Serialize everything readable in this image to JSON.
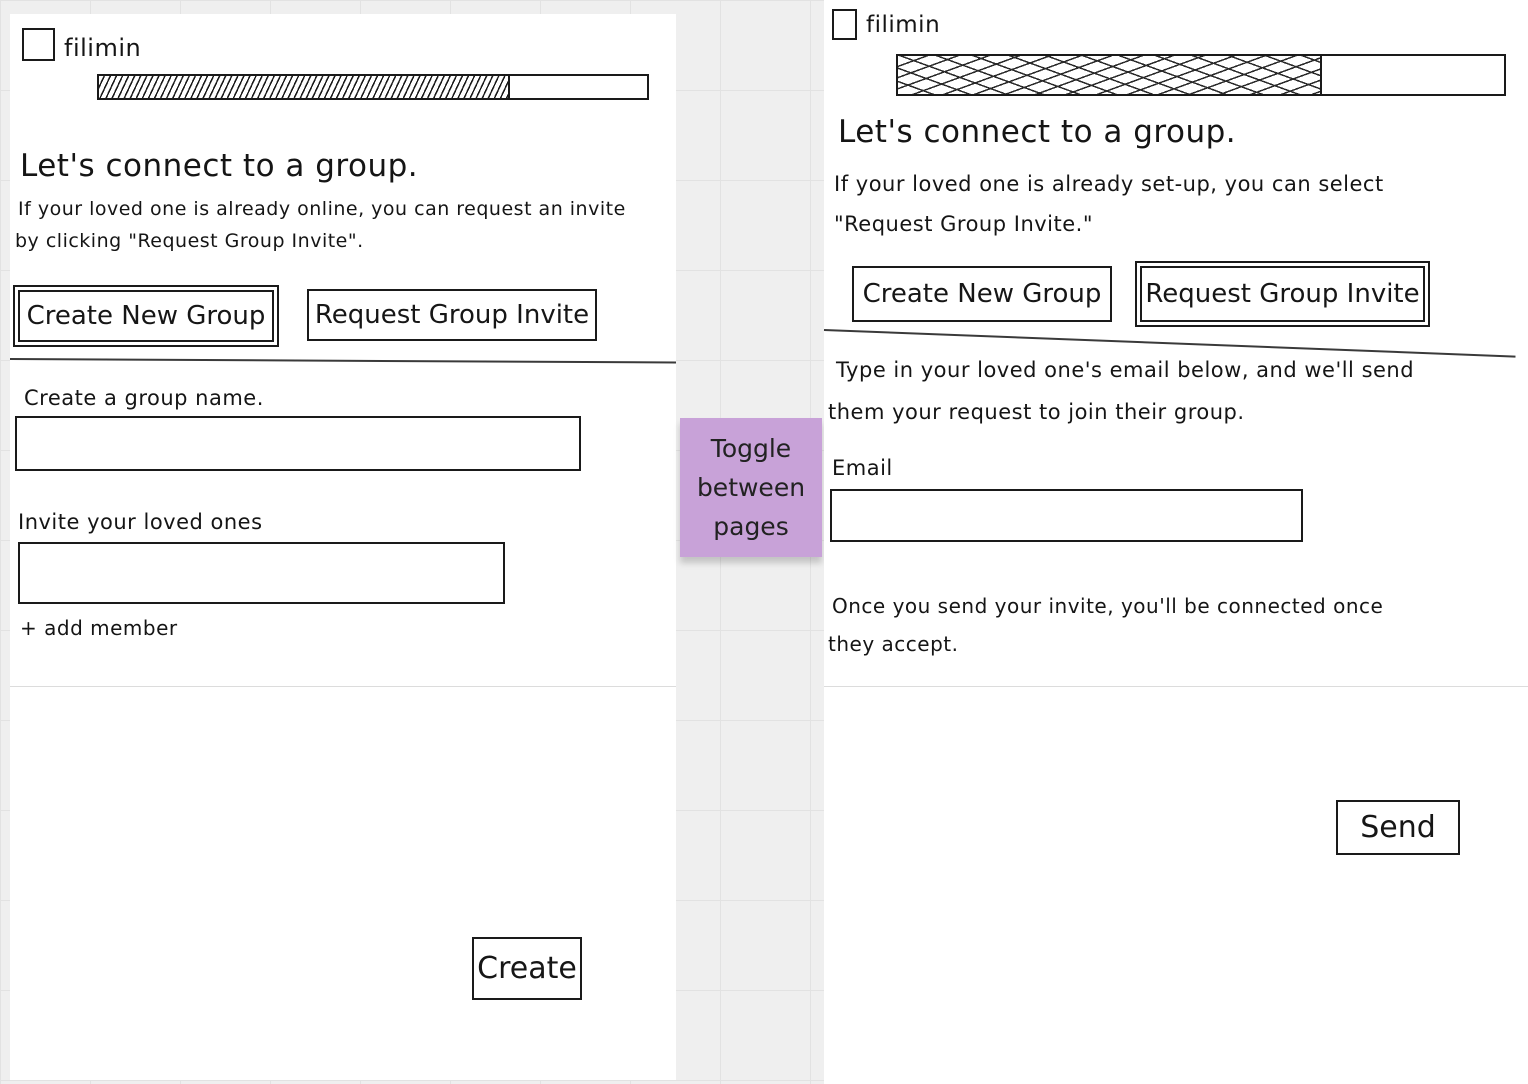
{
  "left_page": {
    "app_name": "filimin",
    "progress": 0.75,
    "heading": "Let's connect to a group.",
    "intro_line1": "If your loved one is already online, you can request an invite",
    "intro_line2": "by clicking \"Request Group Invite\".",
    "tabs": [
      {
        "label": "Create New Group",
        "selected": true
      },
      {
        "label": "Request Group Invite",
        "selected": false
      }
    ],
    "group_name_label": "Create a group name.",
    "invite_label": "Invite your loved ones",
    "add_member": "+ add member",
    "create_button": "Create"
  },
  "sticky_note": {
    "text": "Toggle\nbetween\npages",
    "color": "#c8a2d8"
  },
  "right_page": {
    "app_name": "filimin",
    "progress": 0.7,
    "heading": "Let's connect to a group.",
    "intro_line1": "If your loved one is already set-up, you can select",
    "intro_line2": "\"Request Group Invite.\"",
    "tabs": [
      {
        "label": "Create New Group",
        "selected": false
      },
      {
        "label": "Request Group Invite",
        "selected": true
      }
    ],
    "instructions_line1": "Type in your loved one's email below, and we'll send",
    "instructions_line2": "them your request to join their group.",
    "email_label": "Email",
    "note_line1": "Once you send your invite, you'll be connected once",
    "note_line2": "they accept.",
    "send_button": "Send"
  }
}
